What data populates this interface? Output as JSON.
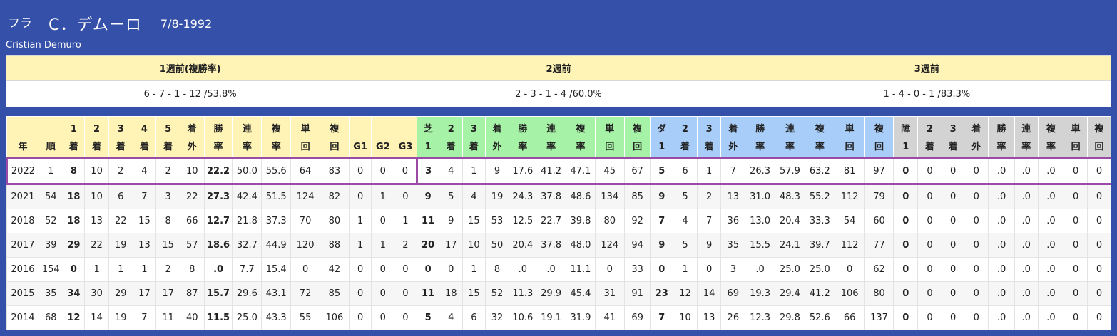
{
  "header": {
    "badge": "フラ",
    "name": "C．デムーロ",
    "birthdate": "7/8-1992",
    "english_name": "Cristian Demuro"
  },
  "recent": {
    "headers": [
      "1週前(複勝率)",
      "2週前",
      "3週前"
    ],
    "values": [
      "6 - 7 - 1 - 12 /53.8%",
      "2 - 3 - 1 - 4 /60.0%",
      "1 - 4 - 0 - 1 /83.3%"
    ]
  },
  "columns": [
    {
      "l1": "",
      "l2": "年",
      "g": "yl"
    },
    {
      "l1": "",
      "l2": "順",
      "g": "yl"
    },
    {
      "l1": "1",
      "l2": "着",
      "g": "yl"
    },
    {
      "l1": "2",
      "l2": "着",
      "g": "yl"
    },
    {
      "l1": "3",
      "l2": "着",
      "g": "yl"
    },
    {
      "l1": "4",
      "l2": "着",
      "g": "yl"
    },
    {
      "l1": "5",
      "l2": "着",
      "g": "yl"
    },
    {
      "l1": "着",
      "l2": "外",
      "g": "yl"
    },
    {
      "l1": "勝",
      "l2": "率",
      "g": "yl"
    },
    {
      "l1": "連",
      "l2": "率",
      "g": "yl"
    },
    {
      "l1": "複",
      "l2": "率",
      "g": "yl"
    },
    {
      "l1": "単",
      "l2": "回",
      "g": "yl"
    },
    {
      "l1": "複",
      "l2": "回",
      "g": "yl"
    },
    {
      "l1": "",
      "l2": "G1",
      "g": "yl"
    },
    {
      "l1": "",
      "l2": "G2",
      "g": "yl"
    },
    {
      "l1": "",
      "l2": "G3",
      "g": "yl"
    },
    {
      "l1": "芝",
      "l2": "1",
      "g": "gr"
    },
    {
      "l1": "2",
      "l2": "着",
      "g": "gr"
    },
    {
      "l1": "3",
      "l2": "着",
      "g": "gr"
    },
    {
      "l1": "着",
      "l2": "外",
      "g": "gr"
    },
    {
      "l1": "勝",
      "l2": "率",
      "g": "gr"
    },
    {
      "l1": "連",
      "l2": "率",
      "g": "gr"
    },
    {
      "l1": "複",
      "l2": "率",
      "g": "gr"
    },
    {
      "l1": "単",
      "l2": "回",
      "g": "gr"
    },
    {
      "l1": "複",
      "l2": "回",
      "g": "gr"
    },
    {
      "l1": "ダ",
      "l2": "1",
      "g": "bl"
    },
    {
      "l1": "2",
      "l2": "着",
      "g": "bl"
    },
    {
      "l1": "3",
      "l2": "着",
      "g": "bl"
    },
    {
      "l1": "着",
      "l2": "外",
      "g": "bl"
    },
    {
      "l1": "勝",
      "l2": "率",
      "g": "bl"
    },
    {
      "l1": "連",
      "l2": "率",
      "g": "bl"
    },
    {
      "l1": "複",
      "l2": "率",
      "g": "bl"
    },
    {
      "l1": "単",
      "l2": "回",
      "g": "bl"
    },
    {
      "l1": "複",
      "l2": "回",
      "g": "bl"
    },
    {
      "l1": "障",
      "l2": "1",
      "g": "gy"
    },
    {
      "l1": "2",
      "l2": "着",
      "g": "gy"
    },
    {
      "l1": "3",
      "l2": "着",
      "g": "gy"
    },
    {
      "l1": "着",
      "l2": "外",
      "g": "gy"
    },
    {
      "l1": "勝",
      "l2": "率",
      "g": "gy"
    },
    {
      "l1": "連",
      "l2": "率",
      "g": "gy"
    },
    {
      "l1": "複",
      "l2": "率",
      "g": "gy"
    },
    {
      "l1": "単",
      "l2": "回",
      "g": "gy"
    },
    {
      "l1": "複",
      "l2": "回",
      "g": "gy"
    }
  ],
  "rows": [
    [
      "2022",
      "1",
      "8",
      "10",
      "2",
      "4",
      "2",
      "10",
      "22.2",
      "50.0",
      "55.6",
      "64",
      "83",
      "0",
      "0",
      "0",
      "3",
      "4",
      "1",
      "9",
      "17.6",
      "41.2",
      "47.1",
      "45",
      "67",
      "5",
      "6",
      "1",
      "7",
      "26.3",
      "57.9",
      "63.2",
      "81",
      "97",
      "0",
      "0",
      "0",
      "0",
      ".0",
      ".0",
      ".0",
      "0",
      "0"
    ],
    [
      "2021",
      "54",
      "18",
      "10",
      "6",
      "7",
      "3",
      "22",
      "27.3",
      "42.4",
      "51.5",
      "124",
      "82",
      "0",
      "1",
      "0",
      "9",
      "5",
      "4",
      "19",
      "24.3",
      "37.8",
      "48.6",
      "134",
      "85",
      "9",
      "5",
      "2",
      "13",
      "31.0",
      "48.3",
      "55.2",
      "112",
      "79",
      "0",
      "0",
      "0",
      "0",
      ".0",
      ".0",
      ".0",
      "0",
      "0"
    ],
    [
      "2018",
      "52",
      "18",
      "13",
      "22",
      "15",
      "8",
      "66",
      "12.7",
      "21.8",
      "37.3",
      "70",
      "80",
      "1",
      "0",
      "1",
      "11",
      "9",
      "15",
      "53",
      "12.5",
      "22.7",
      "39.8",
      "80",
      "92",
      "7",
      "4",
      "7",
      "36",
      "13.0",
      "20.4",
      "33.3",
      "54",
      "60",
      "0",
      "0",
      "0",
      "0",
      ".0",
      ".0",
      ".0",
      "0",
      "0"
    ],
    [
      "2017",
      "39",
      "29",
      "22",
      "19",
      "13",
      "15",
      "57",
      "18.6",
      "32.7",
      "44.9",
      "120",
      "88",
      "1",
      "1",
      "2",
      "20",
      "17",
      "10",
      "50",
      "20.4",
      "37.8",
      "48.0",
      "124",
      "94",
      "9",
      "5",
      "9",
      "35",
      "15.5",
      "24.1",
      "39.7",
      "112",
      "77",
      "0",
      "0",
      "0",
      "0",
      ".0",
      ".0",
      ".0",
      "0",
      "0"
    ],
    [
      "2016",
      "154",
      "0",
      "1",
      "1",
      "1",
      "2",
      "8",
      ".0",
      "7.7",
      "15.4",
      "0",
      "42",
      "0",
      "0",
      "0",
      "0",
      "0",
      "1",
      "8",
      ".0",
      ".0",
      "11.1",
      "0",
      "33",
      "0",
      "1",
      "0",
      "3",
      ".0",
      "25.0",
      "25.0",
      "0",
      "62",
      "0",
      "0",
      "0",
      "0",
      ".0",
      ".0",
      ".0",
      "0",
      "0"
    ],
    [
      "2015",
      "35",
      "34",
      "30",
      "29",
      "17",
      "17",
      "87",
      "15.7",
      "29.6",
      "43.1",
      "72",
      "85",
      "0",
      "0",
      "0",
      "11",
      "18",
      "15",
      "52",
      "11.3",
      "29.9",
      "45.4",
      "31",
      "91",
      "23",
      "12",
      "14",
      "69",
      "19.3",
      "29.4",
      "41.2",
      "106",
      "80",
      "0",
      "0",
      "0",
      "0",
      ".0",
      ".0",
      ".0",
      "0",
      "0"
    ],
    [
      "2014",
      "68",
      "12",
      "14",
      "19",
      "7",
      "11",
      "40",
      "11.5",
      "25.0",
      "43.3",
      "55",
      "106",
      "0",
      "0",
      "0",
      "5",
      "4",
      "6",
      "32",
      "10.6",
      "19.1",
      "31.9",
      "41",
      "69",
      "7",
      "10",
      "13",
      "26",
      "12.3",
      "29.8",
      "52.6",
      "66",
      "137",
      "0",
      "0",
      "0",
      "0",
      ".0",
      ".0",
      ".0",
      "0",
      "0"
    ]
  ],
  "colors": {
    "page_background": "#3450a8",
    "header_yellow": "#fff3b5",
    "turf_green": "#a6f2a6",
    "dirt_blue": "#a8cdf8",
    "jump_gray": "#d3d3d3",
    "highlight_purple": "#9b4aa6"
  }
}
